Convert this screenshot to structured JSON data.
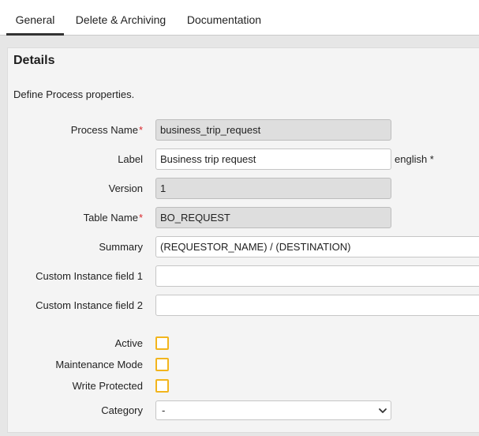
{
  "tabs": [
    {
      "label": "General",
      "active": true
    },
    {
      "label": "Delete & Archiving",
      "active": false
    },
    {
      "label": "Documentation",
      "active": false
    }
  ],
  "details": {
    "title": "Details",
    "description": "Define Process properties."
  },
  "fields": {
    "process_name": {
      "label": "Process Name",
      "required_mark": "*",
      "value": "business_trip_request"
    },
    "label": {
      "label": "Label",
      "value": "Business trip request",
      "language_hint": "english *"
    },
    "version": {
      "label": "Version",
      "value": "1"
    },
    "table_name": {
      "label": "Table Name",
      "required_mark": "*",
      "value": "BO_REQUEST"
    },
    "summary": {
      "label": "Summary",
      "value": "(REQUESTOR_NAME) / (DESTINATION)"
    },
    "custom_instance_field_1": {
      "label": "Custom Instance field 1",
      "value": ""
    },
    "custom_instance_field_2": {
      "label": "Custom Instance field 2",
      "value": ""
    }
  },
  "checkboxes": {
    "active": {
      "label": "Active",
      "checked": false
    },
    "maintenance_mode": {
      "label": "Maintenance Mode",
      "checked": false
    },
    "write_protected": {
      "label": "Write Protected",
      "checked": false
    }
  },
  "category": {
    "label": "Category",
    "selected": "-"
  },
  "colors": {
    "accent_checkbox": "#f2b51d",
    "required": "#d9262b",
    "readonly_bg": "#dedede"
  }
}
